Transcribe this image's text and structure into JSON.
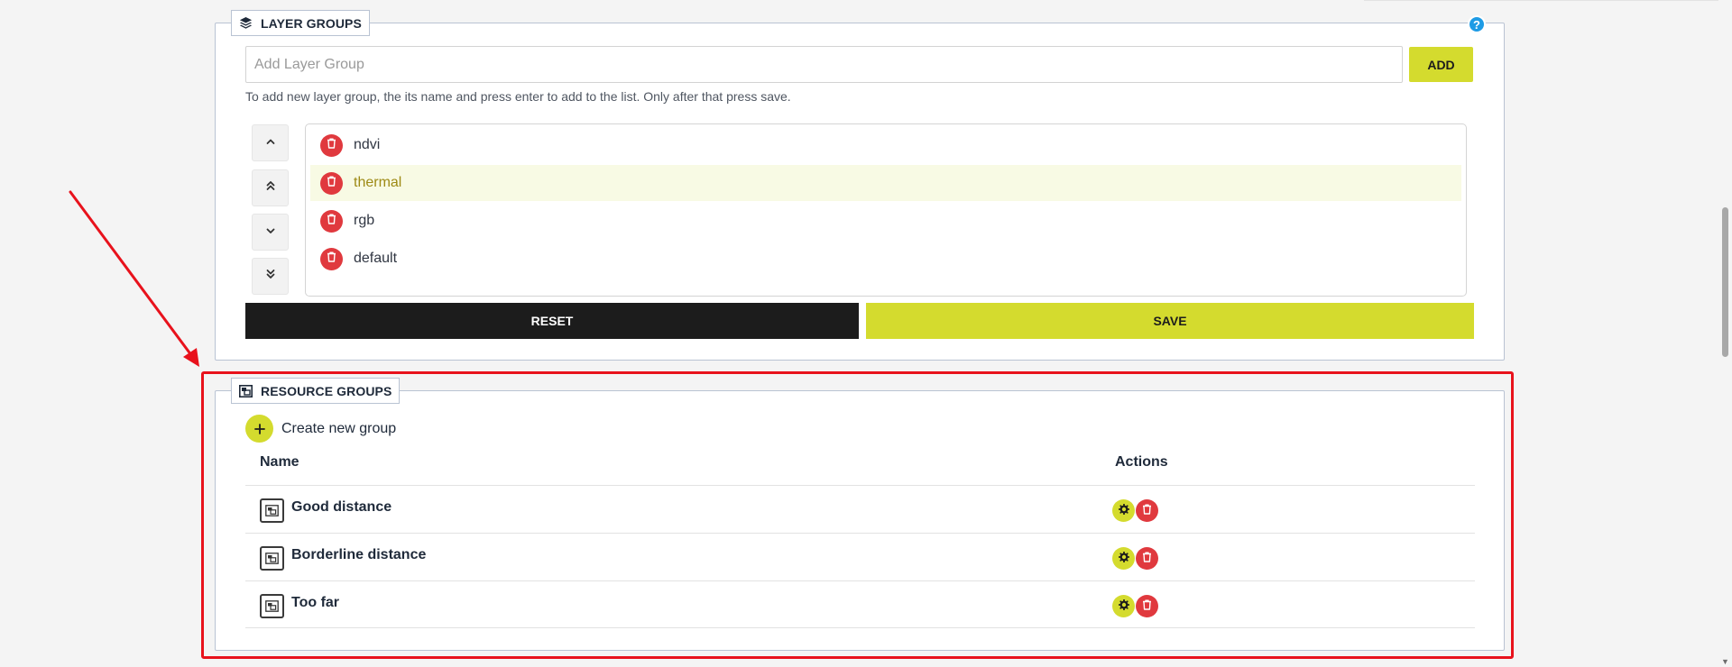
{
  "layer_groups": {
    "title": "LAYER GROUPS",
    "help_label": "?",
    "input_placeholder": "Add Layer Group",
    "input_value": "",
    "add_label": "ADD",
    "hint": "To add new layer group, the its name and press enter to add to the list. Only after that press save.",
    "order_buttons": [
      {
        "icon": "chevron-up-icon"
      },
      {
        "icon": "double-chevron-up-icon"
      },
      {
        "icon": "chevron-down-icon"
      },
      {
        "icon": "double-chevron-down-icon"
      }
    ],
    "items": [
      {
        "label": "ndvi",
        "selected": false
      },
      {
        "label": "thermal",
        "selected": true
      },
      {
        "label": "rgb",
        "selected": false
      },
      {
        "label": "default",
        "selected": false
      }
    ],
    "reset_label": "RESET",
    "save_label": "SAVE"
  },
  "resource_groups": {
    "title": "RESOURCE GROUPS",
    "create_label": "Create new group",
    "columns": {
      "name": "Name",
      "actions": "Actions"
    },
    "rows": [
      {
        "name": "Good distance"
      },
      {
        "name": "Borderline distance"
      },
      {
        "name": "Too far"
      }
    ]
  },
  "colors": {
    "accent": "#d4db2e",
    "danger": "#e0393e",
    "dark": "#1c1c1c",
    "help": "#1e9be5",
    "annotation": "#e8121c"
  }
}
